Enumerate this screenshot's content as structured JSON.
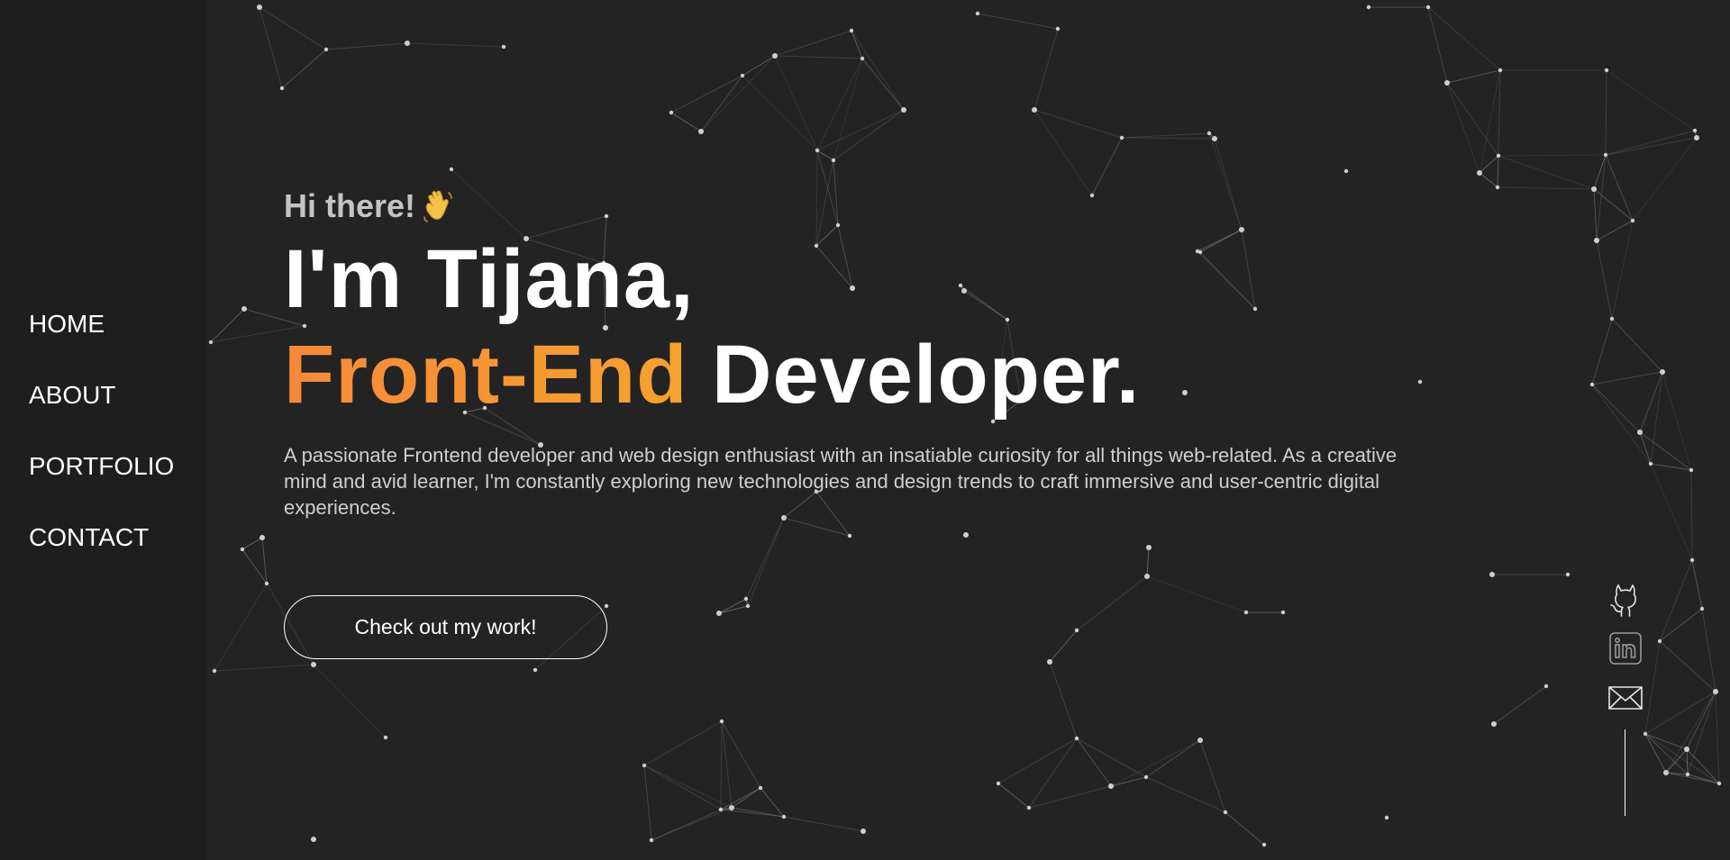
{
  "nav": {
    "items": [
      {
        "label": "HOME"
      },
      {
        "label": "ABOUT"
      },
      {
        "label": "PORTFOLIO"
      },
      {
        "label": "CONTACT"
      }
    ]
  },
  "hero": {
    "greeting": "Hi there!",
    "greeting_icon": "waving-hand-icon",
    "title_line1": "I'm Tijana,",
    "title_accent": "Front-End",
    "title_rest": "Developer.",
    "description": "A passionate Frontend developer and web design enthusiast with an insatiable curiosity for all things web-related. As a creative mind and avid learner, I'm constantly exploring new technologies and design trends to craft immersive and user-centric digital experiences.",
    "cta_label": "Check out my work!"
  },
  "socials": [
    {
      "icon": "github-icon"
    },
    {
      "icon": "linkedin-icon"
    },
    {
      "icon": "mail-icon"
    }
  ],
  "colors": {
    "background": "#232323",
    "sidebar": "#1e1e1e",
    "accent_start": "#f6893a",
    "accent_end": "#f5a22e",
    "text": "#ffffff",
    "muted": "#c4c4c4"
  }
}
